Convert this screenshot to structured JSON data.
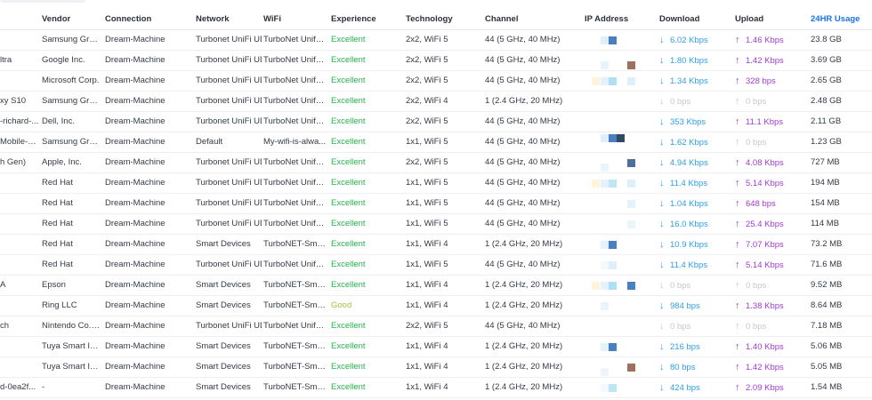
{
  "columns": {
    "vendor": "Vendor",
    "connection": "Connection",
    "network": "Network",
    "wifi": "WiFi",
    "experience": "Experience",
    "technology": "Technology",
    "channel": "Channel",
    "ip": "IP Address",
    "download": "Download",
    "upload": "Upload",
    "usage": "24HR Usage"
  },
  "colors": {
    "excellent": "#26b24a",
    "good": "#a3c43c",
    "download": "#2f9ee6",
    "upload": "#a23bd0",
    "muted": "#c3c8cf",
    "accent": "#1a73e8"
  },
  "icons": {
    "download": "arrow-down-icon",
    "upload": "arrow-up-icon"
  },
  "rows": [
    {
      "name": "",
      "vendor": "Samsung Group",
      "connection": "Dream-Machine",
      "network": "Turbonet UniFi UD",
      "wifi": "TurboNet Unifu ...",
      "experience": "Excellent",
      "exp_level": "excellent",
      "technology": "2x2, WiFi 5",
      "channel": "44 (5 GHz, 40 MHz)",
      "download": "6.02 Kbps",
      "upload": "1.46 Kbps",
      "dl_active": true,
      "ul_active": true,
      "usage": "23.8 GB"
    },
    {
      "name": "ltra",
      "vendor": "Google Inc.",
      "connection": "Dream-Machine",
      "network": "Turbonet UniFi UD",
      "wifi": "TurboNet Unifu ...",
      "experience": "Excellent",
      "exp_level": "excellent",
      "technology": "2x2, WiFi 5",
      "channel": "44 (5 GHz, 40 MHz)",
      "download": "1.80 Kbps",
      "upload": "1.42 Kbps",
      "dl_active": true,
      "ul_active": true,
      "usage": "3.69 GB"
    },
    {
      "name": "",
      "vendor": "Microsoft Corp.",
      "connection": "Dream-Machine",
      "network": "Turbonet UniFi UD",
      "wifi": "TurboNet Unifu ...",
      "experience": "Excellent",
      "exp_level": "excellent",
      "technology": "2x2, WiFi 5",
      "channel": "44 (5 GHz, 40 MHz)",
      "download": "1.34 Kbps",
      "upload": "328 bps",
      "dl_active": true,
      "ul_active": true,
      "usage": "2.65 GB"
    },
    {
      "name": "xy S10",
      "vendor": "Samsung Group",
      "connection": "Dream-Machine",
      "network": "Turbonet UniFi UD",
      "wifi": "TurboNet Unifu ...",
      "experience": "Excellent",
      "exp_level": "excellent",
      "technology": "2x2, WiFi 4",
      "channel": "1 (2.4 GHz, 20 MHz)",
      "download": "0 bps",
      "upload": "0 bps",
      "dl_active": false,
      "ul_active": false,
      "usage": "2.48 GB"
    },
    {
      "name": "-richard-...",
      "vendor": "Dell, Inc.",
      "connection": "Dream-Machine",
      "network": "Turbonet UniFi UD",
      "wifi": "TurboNet Unifu ...",
      "experience": "Excellent",
      "exp_level": "excellent",
      "technology": "2x2, WiFi 5",
      "channel": "44 (5 GHz, 40 MHz)",
      "download": "353 Kbps",
      "upload": "11.1 Kbps",
      "dl_active": true,
      "ul_active": true,
      "usage": "2.11 GB"
    },
    {
      "name": "Mobile-P...",
      "vendor": "Samsung Group",
      "connection": "Dream-Machine",
      "network": "Default",
      "wifi": "My-wifi-is-alwa...",
      "experience": "Excellent",
      "exp_level": "excellent",
      "technology": "1x1, WiFi 5",
      "channel": "44 (5 GHz, 40 MHz)",
      "download": "1.62 Kbps",
      "upload": "0 bps",
      "dl_active": true,
      "ul_active": false,
      "usage": "1.23 GB"
    },
    {
      "name": "h Gen)",
      "vendor": "Apple, Inc.",
      "connection": "Dream-Machine",
      "network": "Turbonet UniFi UD",
      "wifi": "TurboNet Unifu ...",
      "experience": "Excellent",
      "exp_level": "excellent",
      "technology": "2x2, WiFi 5",
      "channel": "44 (5 GHz, 40 MHz)",
      "download": "4.94 Kbps",
      "upload": "4.08 Kbps",
      "dl_active": true,
      "ul_active": true,
      "usage": "727 MB"
    },
    {
      "name": "",
      "vendor": "Red Hat",
      "connection": "Dream-Machine",
      "network": "Turbonet UniFi UD",
      "wifi": "TurboNet Unifu ...",
      "experience": "Excellent",
      "exp_level": "excellent",
      "technology": "1x1, WiFi 5",
      "channel": "44 (5 GHz, 40 MHz)",
      "download": "11.4 Kbps",
      "upload": "5.14 Kbps",
      "dl_active": true,
      "ul_active": true,
      "usage": "194 MB"
    },
    {
      "name": "",
      "vendor": "Red Hat",
      "connection": "Dream-Machine",
      "network": "Turbonet UniFi UD",
      "wifi": "TurboNet Unifu ...",
      "experience": "Excellent",
      "exp_level": "excellent",
      "technology": "1x1, WiFi 5",
      "channel": "44 (5 GHz, 40 MHz)",
      "download": "1.04 Kbps",
      "upload": "648 bps",
      "dl_active": true,
      "ul_active": true,
      "usage": "154 MB"
    },
    {
      "name": "",
      "vendor": "Red Hat",
      "connection": "Dream-Machine",
      "network": "Turbonet UniFi UD",
      "wifi": "TurboNet Unifu ...",
      "experience": "Excellent",
      "exp_level": "excellent",
      "technology": "1x1, WiFi 5",
      "channel": "44 (5 GHz, 40 MHz)",
      "download": "16.0 Kbps",
      "upload": "25.4 Kbps",
      "dl_active": true,
      "ul_active": true,
      "usage": "114 MB"
    },
    {
      "name": "",
      "vendor": "Red Hat",
      "connection": "Dream-Machine",
      "network": "Smart Devices",
      "wifi": "TurboNET-Smar...",
      "experience": "Excellent",
      "exp_level": "excellent",
      "technology": "1x1, WiFi 4",
      "channel": "1 (2.4 GHz, 20 MHz)",
      "download": "10.9 Kbps",
      "upload": "7.07 Kbps",
      "dl_active": true,
      "ul_active": true,
      "usage": "73.2 MB"
    },
    {
      "name": "",
      "vendor": "Red Hat",
      "connection": "Dream-Machine",
      "network": "Turbonet UniFi UD",
      "wifi": "TurboNet Unifu ...",
      "experience": "Excellent",
      "exp_level": "excellent",
      "technology": "1x1, WiFi 5",
      "channel": "44 (5 GHz, 40 MHz)",
      "download": "11.4 Kbps",
      "upload": "5.14 Kbps",
      "dl_active": true,
      "ul_active": true,
      "usage": "71.6 MB"
    },
    {
      "name": "A",
      "vendor": "Epson",
      "connection": "Dream-Machine",
      "network": "Smart Devices",
      "wifi": "TurboNET-Smar...",
      "experience": "Excellent",
      "exp_level": "excellent",
      "technology": "1x1, WiFi 4",
      "channel": "1 (2.4 GHz, 20 MHz)",
      "download": "0 bps",
      "upload": "0 bps",
      "dl_active": false,
      "ul_active": false,
      "usage": "9.52 MB"
    },
    {
      "name": "",
      "vendor": "Ring LLC",
      "connection": "Dream-Machine",
      "network": "Smart Devices",
      "wifi": "TurboNET-Smar...",
      "experience": "Good",
      "exp_level": "good",
      "technology": "1x1, WiFi 4",
      "channel": "1 (2.4 GHz, 20 MHz)",
      "download": "984 bps",
      "upload": "1.38 Kbps",
      "dl_active": true,
      "ul_active": true,
      "usage": "8.64 MB"
    },
    {
      "name": "ch",
      "vendor": "Nintendo Co., ...",
      "connection": "Dream-Machine",
      "network": "Turbonet UniFi UD",
      "wifi": "TurboNet Unifu ...",
      "experience": "Excellent",
      "exp_level": "excellent",
      "technology": "2x2, WiFi 5",
      "channel": "44 (5 GHz, 40 MHz)",
      "download": "0 bps",
      "upload": "0 bps",
      "dl_active": false,
      "ul_active": false,
      "usage": "7.18 MB"
    },
    {
      "name": "",
      "vendor": "Tuya Smart Inc.",
      "connection": "Dream-Machine",
      "network": "Smart Devices",
      "wifi": "TurboNET-Smar...",
      "experience": "Excellent",
      "exp_level": "excellent",
      "technology": "1x1, WiFi 4",
      "channel": "1 (2.4 GHz, 20 MHz)",
      "download": "216 bps",
      "upload": "1.40 Kbps",
      "dl_active": true,
      "ul_active": true,
      "usage": "5.06 MB"
    },
    {
      "name": "",
      "vendor": "Tuya Smart Inc.",
      "connection": "Dream-Machine",
      "network": "Smart Devices",
      "wifi": "TurboNET-Smar...",
      "experience": "Excellent",
      "exp_level": "excellent",
      "technology": "1x1, WiFi 4",
      "channel": "1 (2.4 GHz, 20 MHz)",
      "download": "80 bps",
      "upload": "1.42 Kbps",
      "dl_active": true,
      "ul_active": true,
      "usage": "5.05 MB"
    },
    {
      "name": "d-0ea2f...",
      "vendor": "-",
      "connection": "Dream-Machine",
      "network": "Smart Devices",
      "wifi": "TurboNET-Smar...",
      "experience": "Excellent",
      "exp_level": "excellent",
      "technology": "1x1, WiFi 4",
      "channel": "1 (2.4 GHz, 20 MHz)",
      "download": "424 bps",
      "upload": "2.09 Kbps",
      "dl_active": true,
      "ul_active": true,
      "usage": "1.54 MB"
    }
  ]
}
